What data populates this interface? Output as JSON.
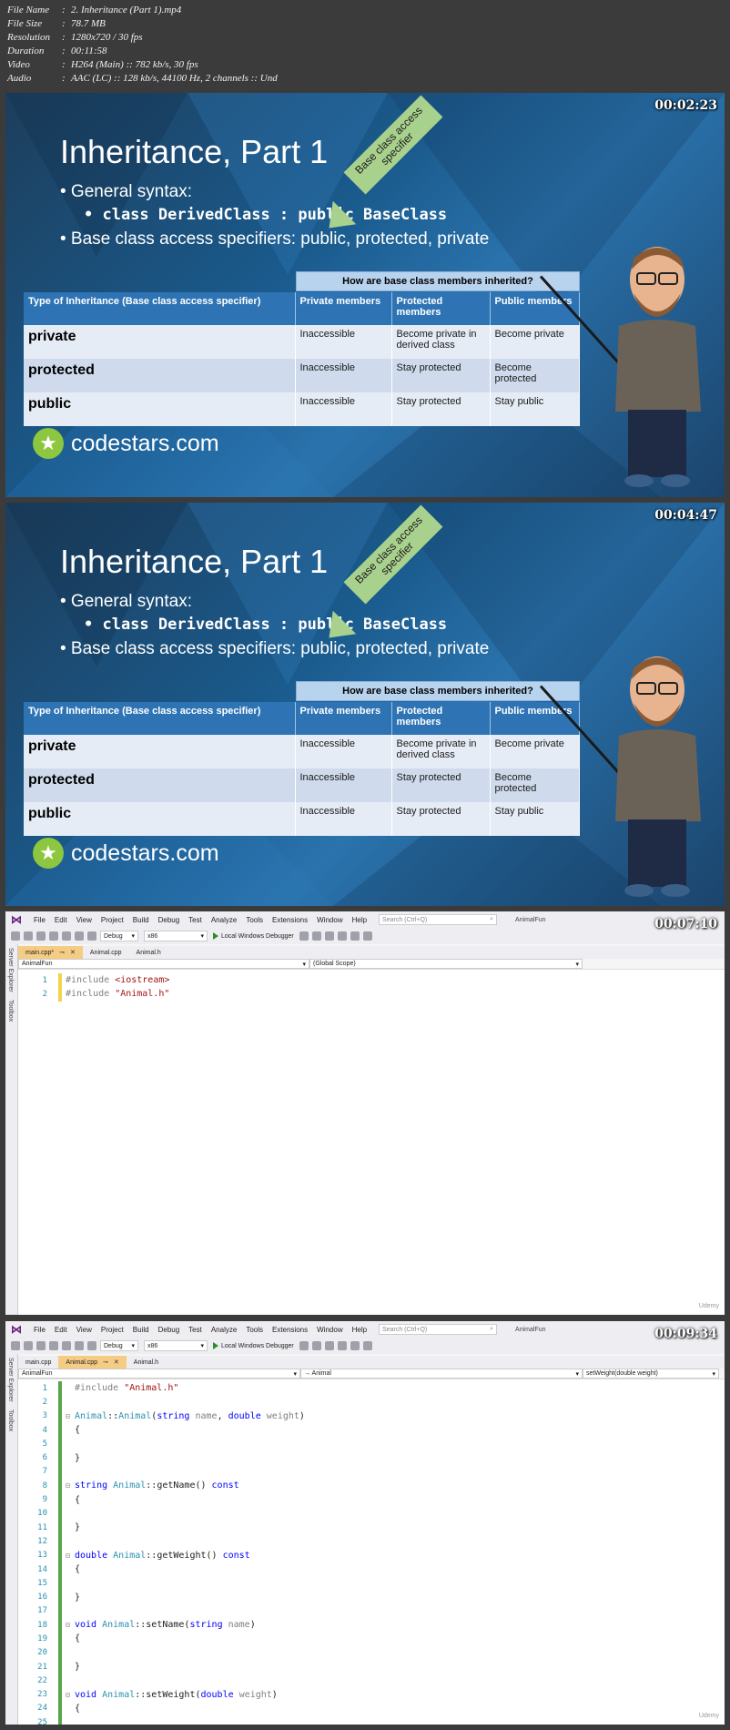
{
  "file_info": [
    {
      "key": "File Name",
      "value": "2. Inheritance (Part 1).mp4"
    },
    {
      "key": "File Size",
      "value": "78.7 MB"
    },
    {
      "key": "Resolution",
      "value": "1280x720 / 30 fps"
    },
    {
      "key": "Duration",
      "value": "00:11:58"
    },
    {
      "key": "Video",
      "value": "H264 (Main) :: 782 kb/s, 30 fps"
    },
    {
      "key": "Audio",
      "value": "AAC (LC) :: 128 kb/s, 44100 Hz, 2 channels :: Und"
    }
  ],
  "frames": [
    {
      "timestamp": "00:02:23"
    },
    {
      "timestamp": "00:04:47"
    },
    {
      "timestamp": "00:07:10"
    },
    {
      "timestamp": "00:09:34"
    }
  ],
  "slide": {
    "title": "Inheritance, Part 1",
    "bullet1": "• General syntax:",
    "bullet2": "• class DerivedClass : public BaseClass",
    "bullet3": "• Base class access specifiers: public, protected, private",
    "arrow_label": "Base class access specifier",
    "table_top_header": "How are base class members inherited?",
    "table_headers": [
      "Type of Inheritance (Base class access specifier)",
      "Private members",
      "Protected members",
      "Public members"
    ],
    "table_rows": [
      [
        "private",
        "Inaccessible",
        "Become private in derived class",
        "Become private"
      ],
      [
        "protected",
        "Inaccessible",
        "Stay protected",
        "Become protected"
      ],
      [
        "public",
        "Inaccessible",
        "Stay protected",
        "Stay public"
      ]
    ],
    "logo_text": "codestars.com"
  },
  "ide": {
    "menu": [
      "File",
      "Edit",
      "View",
      "Project",
      "Build",
      "Debug",
      "Test",
      "Analyze",
      "Tools",
      "Extensions",
      "Window",
      "Help"
    ],
    "search_placeholder": "Search (Ctrl+Q)",
    "solution": "AnimalFun",
    "config": "Debug",
    "platform": "x86",
    "debugger": "Local Windows Debugger",
    "side_tabs": [
      "Server Explorer",
      "Toolbox"
    ],
    "frame3": {
      "tabs": [
        "main.cpp*",
        "Animal.cpp",
        "Animal.h"
      ],
      "nav_project": "AnimalFun",
      "nav_scope": "(Global Scope)",
      "code": [
        {
          "n": "1",
          "a": "#include ",
          "b": "<iostream>"
        },
        {
          "n": "2",
          "a": "#include ",
          "b": "\"Animal.h\""
        }
      ]
    },
    "frame4": {
      "tabs": [
        "main.cpp",
        "Animal.cpp",
        "Animal.h"
      ],
      "nav_project": "AnimalFun",
      "nav_scope": "→ Animal",
      "nav_member": "setWeight(double weight)"
    },
    "watermark": "Udemy"
  }
}
